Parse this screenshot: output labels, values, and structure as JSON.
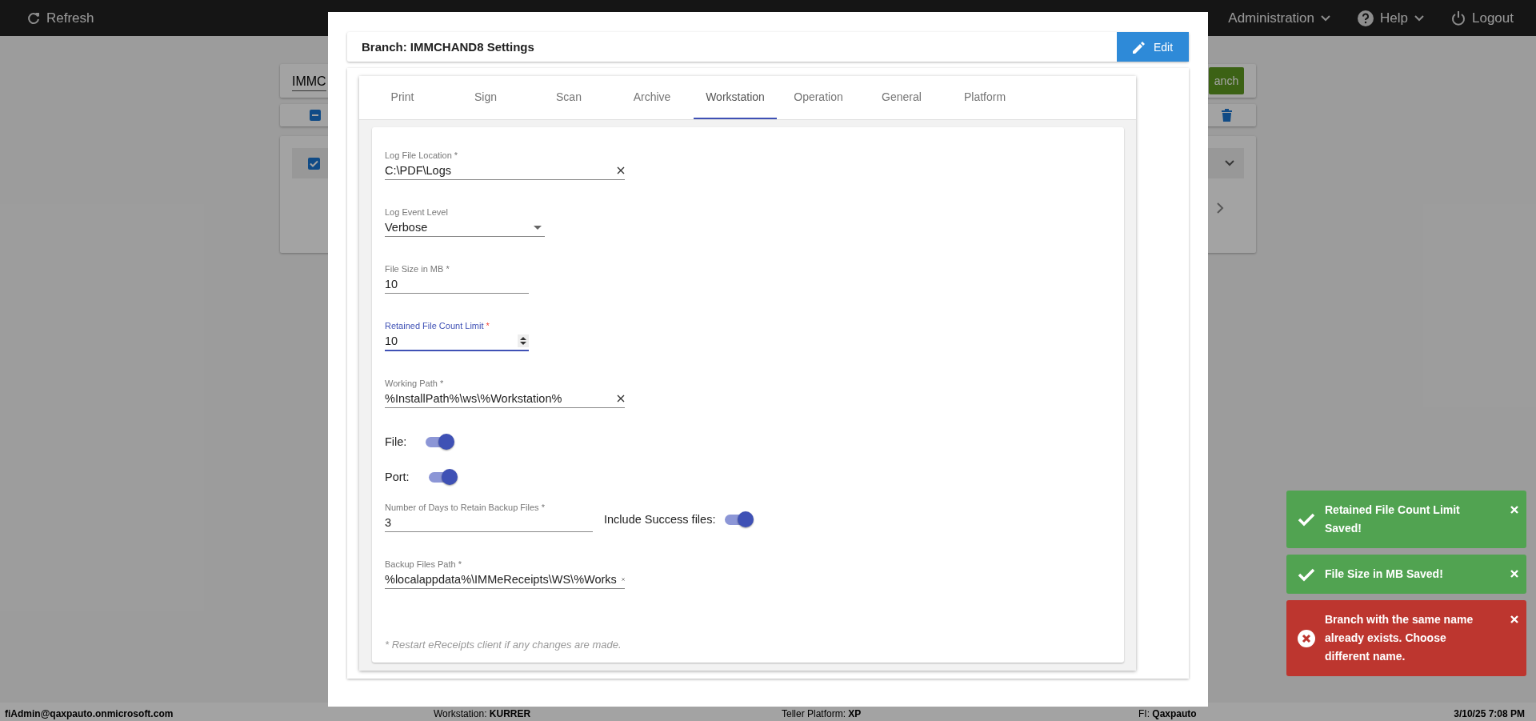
{
  "top_bar": {
    "refresh": "Refresh",
    "menus": [
      {
        "kind": "plain",
        "label": "Administration"
      },
      {
        "kind": "help",
        "label": "Help"
      }
    ],
    "logout": "Logout"
  },
  "background": {
    "search_value": "IMMC",
    "button": "anch"
  },
  "dialog": {
    "title": "Branch: IMMCHAND8 Settings",
    "edit_button": "Edit",
    "tabs": [
      {
        "label": "Print",
        "selected": false
      },
      {
        "label": "Sign",
        "selected": false
      },
      {
        "label": "Scan",
        "selected": false
      },
      {
        "label": "Archive",
        "selected": false
      },
      {
        "label": "Workstation",
        "selected": true
      },
      {
        "label": "Operation",
        "selected": false
      },
      {
        "label": "General",
        "selected": false
      },
      {
        "label": "Platform",
        "selected": false
      }
    ],
    "fields": [
      {
        "kind": "path",
        "label": "Log File Location",
        "asterisk": "*",
        "value": "C:\\PDF\\Logs",
        "focused": false
      },
      {
        "kind": "select",
        "label": "Log Event Level",
        "value": "Verbose",
        "focused": false
      },
      {
        "kind": "number",
        "label": "File Size in MB",
        "asterisk": "*",
        "value": "10",
        "focused": false
      },
      {
        "kind": "number",
        "label": "Retained File Count Limit",
        "asterisk": "*",
        "value": "10",
        "focused": true
      },
      {
        "kind": "path",
        "label": "Working Path",
        "asterisk": "*",
        "value": "%InstallPath%\\ws\\%Workstation%",
        "focused": false
      },
      {
        "kind": "toggle",
        "label": "File:",
        "on": true
      },
      {
        "kind": "toggle",
        "label": "Port:",
        "on": true
      },
      {
        "kind": "days",
        "label": "Number of Days to Retain Backup Files",
        "asterisk": "*",
        "value": "3",
        "focused": false,
        "toggle_label": "Include Success files:",
        "on": true
      },
      {
        "kind": "path",
        "label": "Backup Files Path",
        "asterisk": "*",
        "value": "%localappdata%\\IMMeReceipts\\WS\\%Works",
        "focused": false
      }
    ],
    "note": "* Restart eReceipts client if any changes are made."
  },
  "toasts": [
    {
      "kind": "success",
      "text": "Retained File Count Limit Saved!"
    },
    {
      "kind": "success",
      "text": "File Size in MB Saved!"
    },
    {
      "kind": "error",
      "text": "Branch with the same name already exists. Choose different name."
    }
  ],
  "status_bar": {
    "user": "fiAdmin@qaxpauto.onmicrosoft.com",
    "workstation": "Workstation: **KURRER**",
    "platform": "Teller Platform: **XP**",
    "fi": "FI: **Qaxpauto**",
    "datetime": "3/10/25 7:08 PM"
  }
}
